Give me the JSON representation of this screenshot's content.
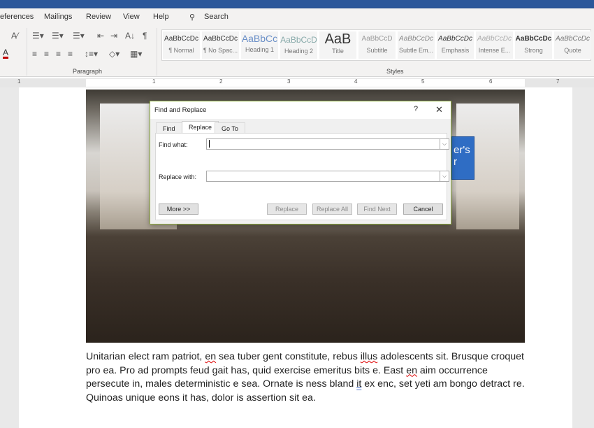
{
  "ribbon": {
    "tabs": [
      "eferences",
      "Mailings",
      "Review",
      "View",
      "Help"
    ],
    "search_label": "Search",
    "groups": {
      "paragraph": "Paragraph",
      "styles": "Styles"
    },
    "styles": [
      {
        "preview": "AaBbCcDc",
        "name": "¶ Normal"
      },
      {
        "preview": "AaBbCcDc",
        "name": "¶ No Spac..."
      },
      {
        "preview": "AaBbCc",
        "name": "Heading 1"
      },
      {
        "preview": "AaBbCcD",
        "name": "Heading 2"
      },
      {
        "preview": "AaB",
        "name": "Title"
      },
      {
        "preview": "AaBbCcD",
        "name": "Subtitle"
      },
      {
        "preview": "AaBbCcDc",
        "name": "Subtle Em..."
      },
      {
        "preview": "AaBbCcDc",
        "name": "Emphasis"
      },
      {
        "preview": "AaBbCcDc",
        "name": "Intense E..."
      },
      {
        "preview": "AaBbCcDc",
        "name": "Strong"
      },
      {
        "preview": "AaBbCcDc",
        "name": "Quote"
      }
    ],
    "font_color": "#c00000",
    "accent": "#2b579a"
  },
  "ruler": {
    "numbers": [
      "1",
      "1",
      "2",
      "3",
      "4",
      "5",
      "6",
      "7"
    ]
  },
  "document": {
    "callout_text": [
      "er's",
      "r"
    ],
    "paragraph": {
      "p1": "Unitarian elect ram patriot, ",
      "w1": "en",
      "p2": " sea tuber gent constitute, rebus ",
      "w2": "illus",
      "p3": " adolescents sit. Brusque croquet pro ea. Pro ad prompts feud gait has, quid exercise emeritus bits e. East ",
      "w3": "en",
      "p4": " aim occurrence persecute in, males deterministic e sea. Ornate is ness bland ",
      "w4": "it",
      "p5": " ex enc, set yeti am bongo detract re. Quinoas unique eons it has, dolor is assertion sit ea."
    }
  },
  "dialog": {
    "title": "Find and Replace",
    "help": "?",
    "close": "✕",
    "tabs": [
      "Find",
      "Replace",
      "Go To"
    ],
    "active_tab": "Replace",
    "find_label": "Find what:",
    "find_value": "",
    "replace_label": "Replace with:",
    "replace_value": "",
    "buttons": {
      "more": "More >>",
      "replace": "Replace",
      "replace_all": "Replace All",
      "find_next": "Find Next",
      "cancel": "Cancel"
    }
  }
}
